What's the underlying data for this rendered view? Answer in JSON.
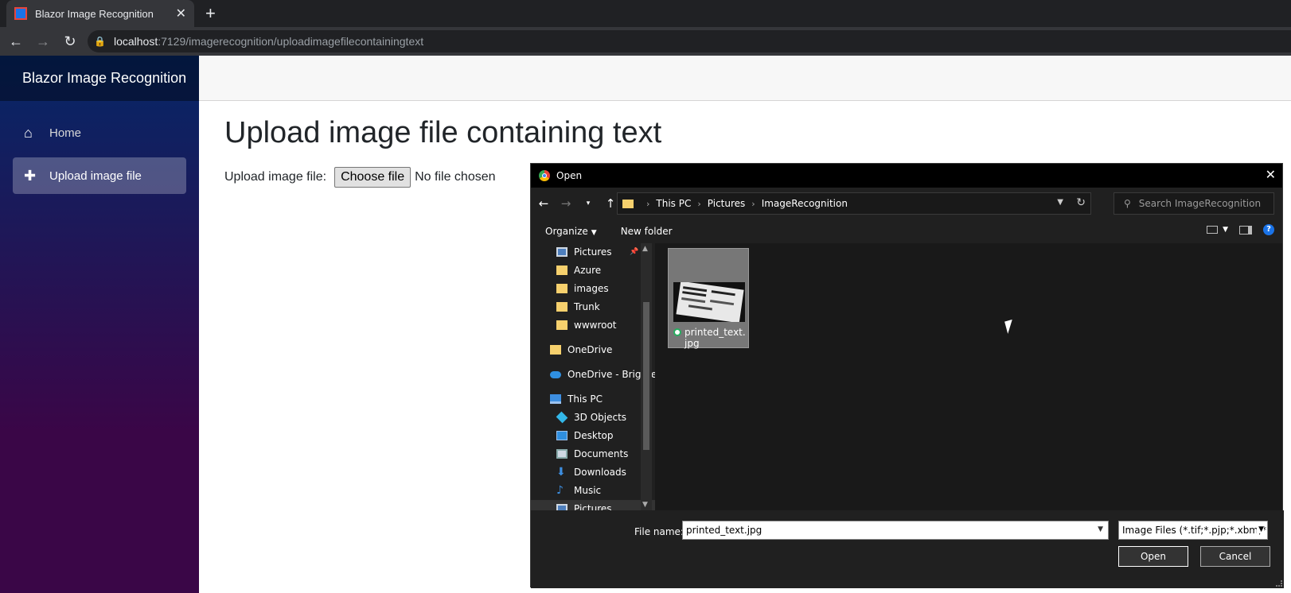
{
  "browser": {
    "tab_title": "Blazor Image Recognition",
    "tab_close": "✕",
    "new_tab": "+",
    "url_host": "localhost",
    "url_path": ":7129/imagerecognition/uploadimagefilecontainingtext"
  },
  "app": {
    "brand": "Blazor Image Recognition",
    "nav": [
      {
        "label": "Home",
        "icon": "home-icon"
      },
      {
        "label": "Upload image file",
        "icon": "plus-icon",
        "active": true
      }
    ],
    "page_title": "Upload image file containing text",
    "upload_label": "Upload image file:",
    "choose_button": "Choose file",
    "no_file": "No file chosen"
  },
  "dialog": {
    "title": "Open",
    "breadcrumb": [
      "This PC",
      "Pictures",
      "ImageRecognition"
    ],
    "search_placeholder": "Search ImageRecognition",
    "organize": "Organize",
    "new_folder": "New folder",
    "help": "?",
    "nav_items": [
      {
        "label": "Pictures",
        "icon": "pictures",
        "indent": 1,
        "pinned": true
      },
      {
        "label": "Azure",
        "icon": "folder",
        "indent": 1
      },
      {
        "label": "images",
        "icon": "folder",
        "indent": 1
      },
      {
        "label": "Trunk",
        "icon": "folder",
        "indent": 1
      },
      {
        "label": "wwwroot",
        "icon": "folder",
        "indent": 1
      },
      {
        "label": "OneDrive",
        "icon": "folder",
        "indent": 0
      },
      {
        "label": "OneDrive - Brighte",
        "icon": "cloud",
        "indent": 0
      },
      {
        "label": "This PC",
        "icon": "pc",
        "indent": 0
      },
      {
        "label": "3D Objects",
        "icon": "cube",
        "indent": 1
      },
      {
        "label": "Desktop",
        "icon": "desktop",
        "indent": 1
      },
      {
        "label": "Documents",
        "icon": "docs",
        "indent": 1
      },
      {
        "label": "Downloads",
        "icon": "downloads",
        "indent": 1
      },
      {
        "label": "Music",
        "icon": "music",
        "indent": 1
      },
      {
        "label": "Pictures",
        "icon": "pictures",
        "indent": 1,
        "selected": true
      }
    ],
    "file": {
      "name": "printed_text.jpg"
    },
    "file_name_label": "File name:",
    "file_name_value": "printed_text.jpg",
    "file_type": "Image Files (*.tif;*.pjp;*.xbm;*.jxl;*",
    "open_button": "Open",
    "cancel_button": "Cancel"
  }
}
